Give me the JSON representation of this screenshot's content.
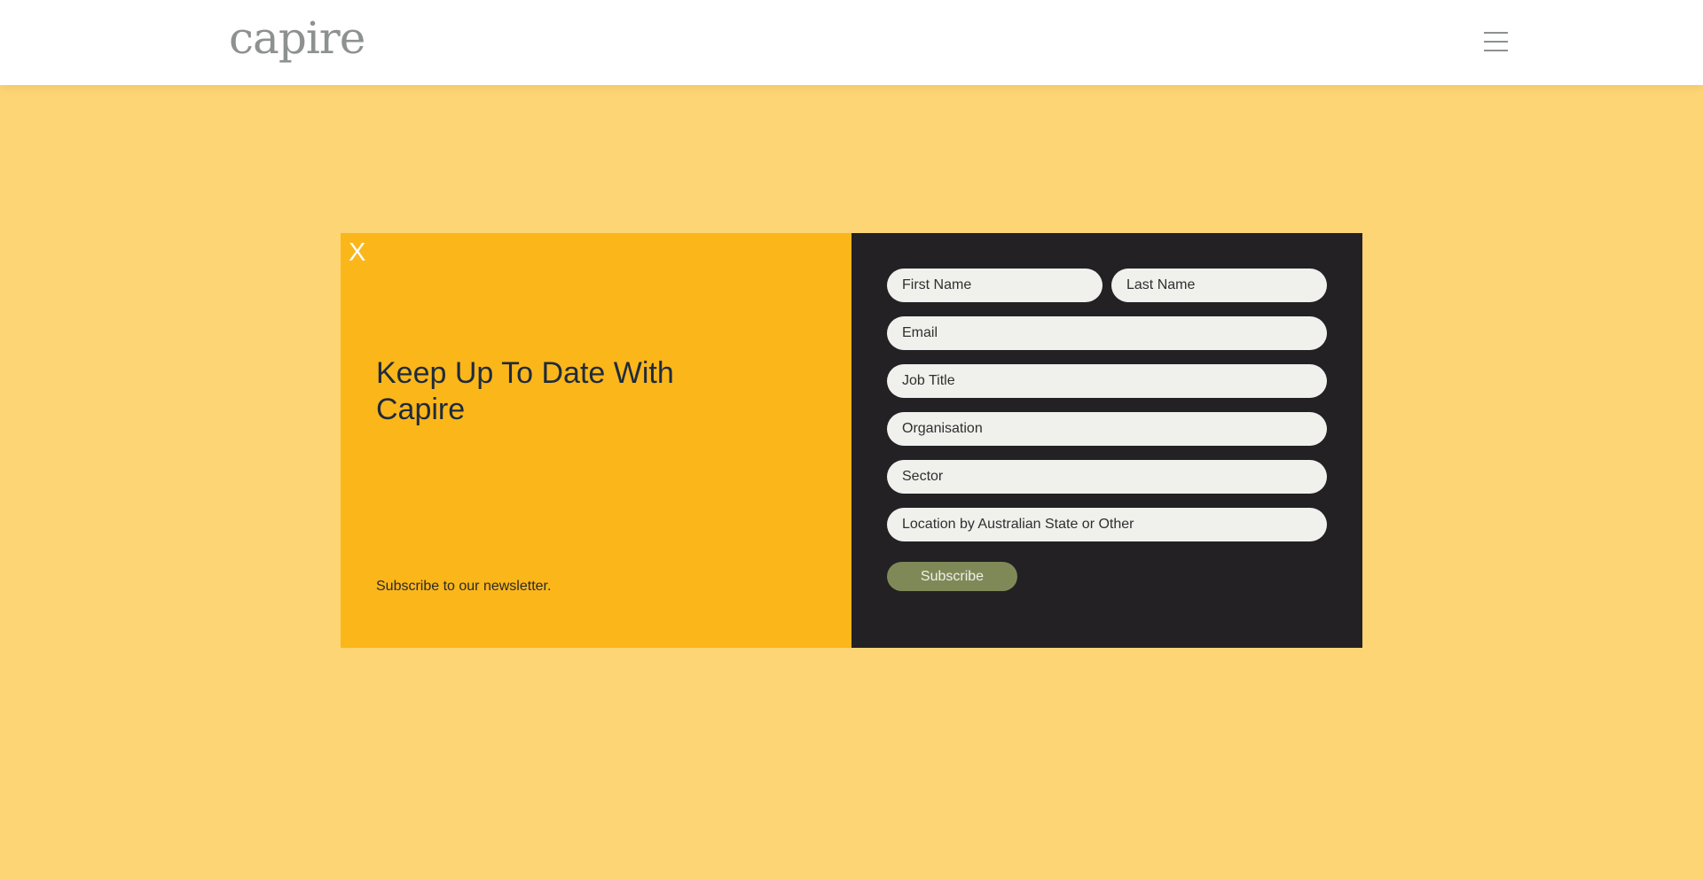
{
  "header": {
    "logo": "capire",
    "menu_icon": "hamburger-menu-icon"
  },
  "modal": {
    "close_label": "X",
    "heading": "Keep Up To Date With Capire",
    "subtext": "Subscribe to our newsletter.",
    "fields": {
      "first_name": "First Name",
      "last_name": "Last Name",
      "email": "Email",
      "job_title": "Job Title",
      "organisation": "Organisation",
      "sector": "Sector",
      "location": "Location by Australian State or Other"
    },
    "subscribe_label": "Subscribe"
  },
  "colors": {
    "page_bg": "#fdd575",
    "panel_yellow": "#fbb61a",
    "panel_dark": "#232124",
    "button": "#7f8958"
  }
}
